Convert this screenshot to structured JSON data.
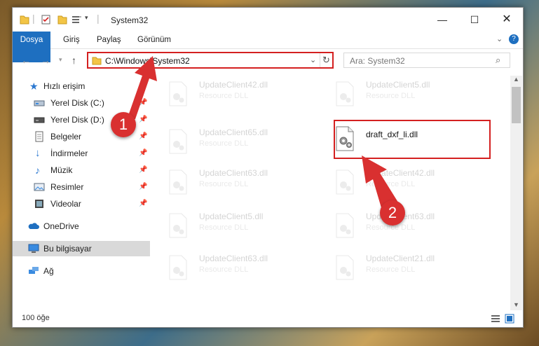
{
  "window": {
    "title": "System32"
  },
  "ribbon": {
    "tabs": [
      "Dosya",
      "Giriş",
      "Paylaş",
      "Görünüm"
    ]
  },
  "nav": {
    "address": "C:\\Windows\\System32",
    "search_placeholder": "Ara: System32"
  },
  "sidebar": {
    "items": [
      {
        "label": "Hızlı erişim",
        "icon": "star-icon"
      },
      {
        "label": "Yerel Disk (C:)",
        "icon": "drive-icon"
      },
      {
        "label": "Yerel Disk (D:)",
        "icon": "drive-icon"
      },
      {
        "label": "Belgeler",
        "icon": "document-icon"
      },
      {
        "label": "İndirmeler",
        "icon": "download-icon"
      },
      {
        "label": "Müzik",
        "icon": "music-icon"
      },
      {
        "label": "Resimler",
        "icon": "picture-icon"
      },
      {
        "label": "Videolar",
        "icon": "video-icon"
      },
      {
        "label": "OneDrive",
        "icon": "cloud-icon"
      },
      {
        "label": "Bu bilgisayar",
        "icon": "computer-icon"
      },
      {
        "label": "Ağ",
        "icon": "network-icon"
      }
    ]
  },
  "files": {
    "left": [
      {
        "name": "UpdateClient42.dll",
        "type": "Resource DLL"
      },
      {
        "name": "UpdateClient65.dll",
        "type": "Resource DLL"
      },
      {
        "name": "UpdateClient63.dll",
        "type": "Resource DLL"
      },
      {
        "name": "UpdateClient5.dll",
        "type": "Resource DLL"
      },
      {
        "name": "UpdateClient63.dll",
        "type": "Resource DLL"
      }
    ],
    "right": [
      {
        "name": "UpdateClient5.dll",
        "type": "Resource DLL"
      },
      {
        "name": "draft_dxf_li.dll",
        "type": ""
      },
      {
        "name": "UpdateClient42.dll",
        "type": "Resource DLL"
      },
      {
        "name": "UpdateClient63.dll",
        "type": "Resource DLL"
      },
      {
        "name": "UpdateClient21.dll",
        "type": "Resource DLL"
      }
    ]
  },
  "status": {
    "count": "100 öğe"
  },
  "annotations": {
    "badge1": "1",
    "badge2": "2"
  },
  "colors": {
    "accent": "#1e6fc0",
    "highlight": "#d42020",
    "badge": "#d93030"
  }
}
